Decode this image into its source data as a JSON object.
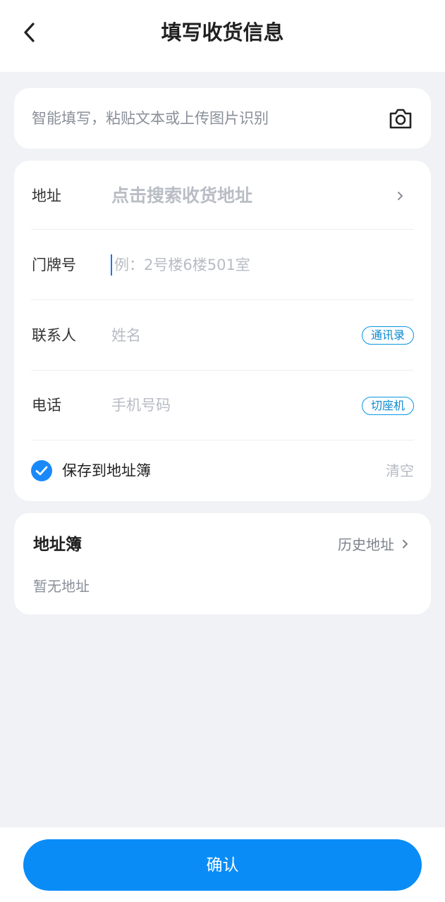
{
  "header": {
    "title": "填写收货信息",
    "back_icon": "chevron-left-icon"
  },
  "smart_fill": {
    "placeholder": "智能填写，粘贴文本或上传图片识别",
    "icon": "camera-icon"
  },
  "form": {
    "address": {
      "label": "地址",
      "placeholder": "点击搜索收货地址",
      "icon": "chevron-right-icon"
    },
    "house_number": {
      "label": "门牌号",
      "placeholder": "例：2号楼6楼501室"
    },
    "contact": {
      "label": "联系人",
      "placeholder": "姓名",
      "button": "通讯录"
    },
    "phone": {
      "label": "电话",
      "placeholder": "手机号码",
      "button": "切座机"
    },
    "save": {
      "label": "保存到地址簿",
      "checked": true,
      "clear_label": "清空"
    }
  },
  "address_book": {
    "title": "地址簿",
    "history_label": "历史地址",
    "empty_text": "暂无地址"
  },
  "footer": {
    "confirm_label": "确认"
  },
  "colors": {
    "accent": "#0a8cf7",
    "background": "#f0f2f5",
    "pill": "#0a96e0"
  }
}
